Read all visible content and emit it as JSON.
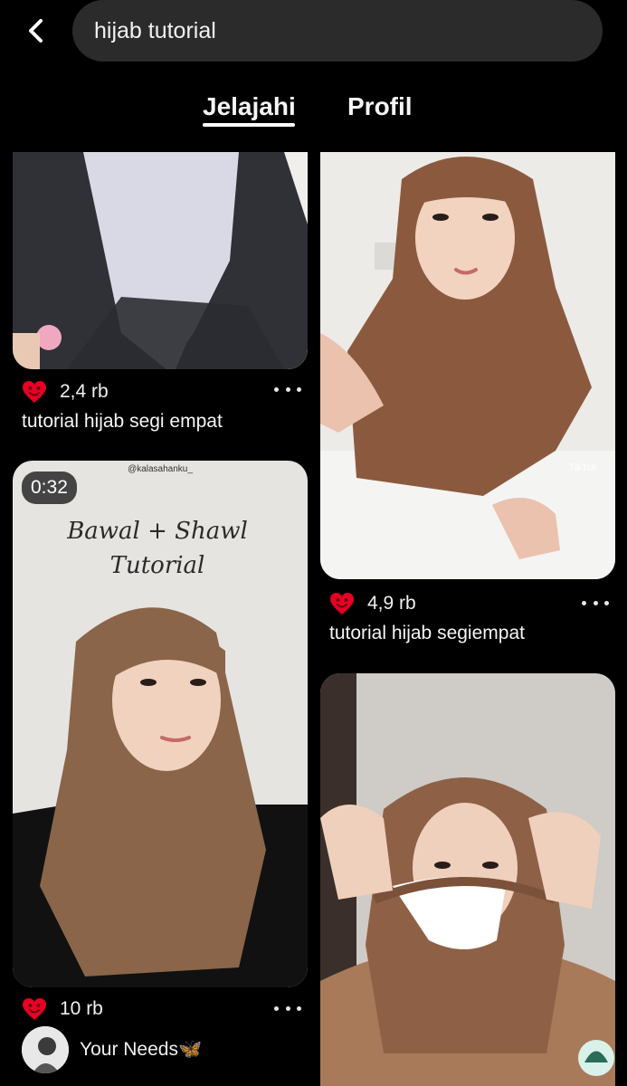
{
  "search": {
    "query": "hijab tutorial"
  },
  "tabs": [
    {
      "label": "Jelajahi",
      "active": true
    },
    {
      "label": "Profil",
      "active": false
    }
  ],
  "pins": [
    {
      "likes": "2,4 rb",
      "title": "tutorial hijab segi empat",
      "has_menu": true
    },
    {
      "likes": "4,9 rb",
      "title": "tutorial hijab segiempat",
      "has_menu": true,
      "watermark": "TikTok"
    },
    {
      "duration": "0:32",
      "image_text": {
        "handle": "@kalasahanku_",
        "line1": "Bawal + Shawl",
        "line2": "Tutorial"
      },
      "likes": "10 rb",
      "author": "Your Needs🦋",
      "has_menu": true
    },
    {
      "likes": "",
      "title": ""
    }
  ],
  "colors": {
    "background": "#000000",
    "search_bg": "#2b2b2b",
    "heart": "#e60023"
  }
}
